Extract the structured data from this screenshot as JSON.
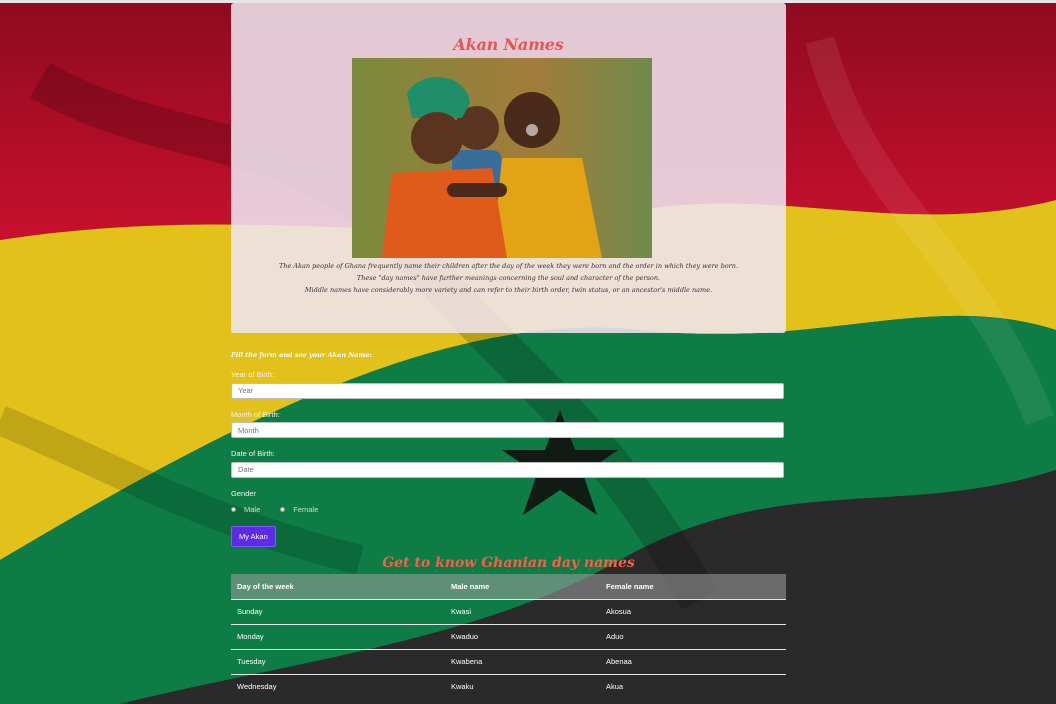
{
  "colors": {
    "red": "#c8102e",
    "gold": "#f2c300",
    "green": "#00864f",
    "star": "#111111",
    "accent_title": "#e4555a",
    "button": "#5b2be6"
  },
  "hero": {
    "title": "Akan Names",
    "image_alt": "three smiling children hugging",
    "intro_lines": [
      "The Akan people of Ghana frequently name their children after the day of the week they were born and the order in which they were born.",
      "These \"day names\" have further meanings concerning the soul and character of the person.",
      "Middle names have considerably more variety and can refer to their birth order, twin status, or an ancestor's middle name."
    ]
  },
  "form": {
    "title": "Fill the form and see your Akan Name:",
    "year_label": "Year of Birth:",
    "year_placeholder": "Year",
    "month_label": "Month of Birth:",
    "month_placeholder": "Month",
    "date_label": "Date of Birth:",
    "date_placeholder": "Date",
    "gender_label": "Gender",
    "male_label": "Male",
    "female_label": "Female",
    "submit_label": "My Akan"
  },
  "table": {
    "title": "Get to know Ghanian day names",
    "headers": [
      "Day of the week",
      "Male name",
      "Female name"
    ],
    "rows": [
      [
        "Sunday",
        "Kwasi",
        "Akosua"
      ],
      [
        "Monday",
        "Kwaduo",
        "Aduo"
      ],
      [
        "Tuesday",
        "Kwabena",
        "Abenaa"
      ],
      [
        "Wednesday",
        "Kwaku",
        "Akua"
      ]
    ]
  }
}
